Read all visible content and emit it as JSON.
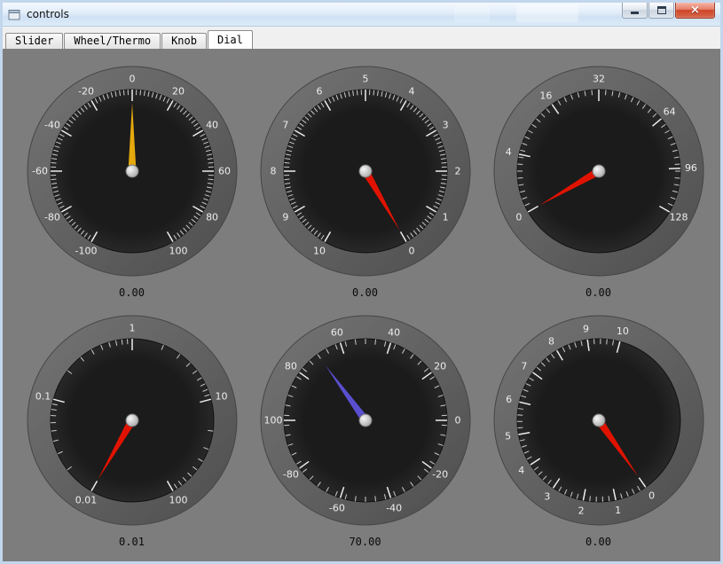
{
  "window": {
    "title": "controls"
  },
  "titlebar": {
    "close_glyph": "×"
  },
  "tabs": [
    {
      "label": "Slider",
      "selected": false
    },
    {
      "label": "Wheel/Thermo",
      "selected": false
    },
    {
      "label": "Knob",
      "selected": false
    },
    {
      "label": "Dial",
      "selected": true
    }
  ],
  "colors": {
    "panel_bg": "#7d7d7d",
    "bezel": "#5f5f5f",
    "dial_face": "#1e1e1e",
    "tick": "#dcdcdc",
    "scale_label": "#ededed",
    "needle_red": "#e11300",
    "needle_yellow": "#e5a90c",
    "needle_purple": "#5a4fcf",
    "hub": "#d9d9d9"
  },
  "dials": [
    {
      "caption": "0.00",
      "needle": {
        "angle": 0,
        "color": "#e5a90c"
      },
      "scale": {
        "start": -150,
        "end": 150,
        "minor_step": 3
      },
      "labels": [
        {
          "text": "-100",
          "angle": -150
        },
        {
          "text": "-80",
          "angle": -120
        },
        {
          "text": "-60",
          "angle": -90
        },
        {
          "text": "-40",
          "angle": -60
        },
        {
          "text": "-20",
          "angle": -30
        },
        {
          "text": "0",
          "angle": 0
        },
        {
          "text": "20",
          "angle": 30
        },
        {
          "text": "40",
          "angle": 60
        },
        {
          "text": "60",
          "angle": 90
        },
        {
          "text": "80",
          "angle": 120
        },
        {
          "text": "100",
          "angle": 150
        }
      ]
    },
    {
      "caption": "0.00",
      "needle": {
        "angle": 150,
        "color": "#e11300"
      },
      "scale": {
        "start": -150,
        "end": 150,
        "minor_step": 3
      },
      "labels": [
        {
          "text": "0",
          "angle": 150
        },
        {
          "text": "1",
          "angle": 120
        },
        {
          "text": "2",
          "angle": 90
        },
        {
          "text": "3",
          "angle": 60
        },
        {
          "text": "4",
          "angle": 30
        },
        {
          "text": "5",
          "angle": 0
        },
        {
          "text": "6",
          "angle": -30
        },
        {
          "text": "7",
          "angle": -60
        },
        {
          "text": "8",
          "angle": -90
        },
        {
          "text": "9",
          "angle": -120
        },
        {
          "text": "10",
          "angle": -150
        }
      ]
    },
    {
      "caption": "0.00",
      "needle": {
        "angle": -120,
        "color": "#e11300"
      },
      "scale": {
        "start": -120,
        "end": 120,
        "minor_step": 5
      },
      "labels": [
        {
          "text": "0",
          "angle": -120
        },
        {
          "text": "4",
          "angle": -78
        },
        {
          "text": "16",
          "angle": -35
        },
        {
          "text": "32",
          "angle": 0
        },
        {
          "text": "64",
          "angle": 50
        },
        {
          "text": "96",
          "angle": 88
        },
        {
          "text": "128",
          "angle": 120
        }
      ]
    },
    {
      "caption": "0.01",
      "needle": {
        "angle": -150,
        "color": "#e11300"
      },
      "scale": {
        "start": -150,
        "end": 150,
        "minor_angles": [
          -127.4,
          -114.2,
          -104.9,
          -97.6,
          -91.7,
          -86.6,
          -82.3,
          -78.4,
          -52.4,
          -39.2,
          -29.9,
          -22.6,
          -16.6,
          -11.6,
          -7.3,
          -3.4,
          22.6,
          35.8,
          45.2,
          52.4,
          58.4,
          63.4,
          67.7,
          71.6,
          97.6,
          110.8,
          120.2,
          127.4,
          133.4,
          138.4,
          142.7,
          146.6
        ]
      },
      "labels": [
        {
          "text": "0.01",
          "angle": -150
        },
        {
          "text": "0.1",
          "angle": -75
        },
        {
          "text": "1",
          "angle": 0
        },
        {
          "text": "10",
          "angle": 75
        },
        {
          "text": "100",
          "angle": 150
        }
      ]
    },
    {
      "caption": "70.00",
      "needle": {
        "angle": -36,
        "color": "#5a4fcf"
      },
      "scale": {
        "start": -180,
        "end": 172.8,
        "minor_step": 7.2
      },
      "labels": [
        {
          "text": "0",
          "angle": 90
        },
        {
          "text": "20",
          "angle": 54
        },
        {
          "text": "40",
          "angle": 18
        },
        {
          "text": "60",
          "angle": -18
        },
        {
          "text": "80",
          "angle": -54
        },
        {
          "text": "100",
          "angle": -90
        },
        {
          "text": "-20",
          "angle": 126
        },
        {
          "text": "-40",
          "angle": 162
        },
        {
          "text": "-60",
          "angle": -162
        },
        {
          "text": "-80",
          "angle": -126
        }
      ]
    },
    {
      "caption": "0.00",
      "needle": {
        "angle": 145,
        "color": "#e11300"
      },
      "scale": {
        "start": 145,
        "end": 375,
        "minor_step": 4.6
      },
      "labels": [
        {
          "text": "0",
          "angle": 145
        },
        {
          "text": "1",
          "angle": 168
        },
        {
          "text": "2",
          "angle": -169
        },
        {
          "text": "3",
          "angle": -146
        },
        {
          "text": "4",
          "angle": -123
        },
        {
          "text": "5",
          "angle": -100
        },
        {
          "text": "6",
          "angle": -77
        },
        {
          "text": "7",
          "angle": -54
        },
        {
          "text": "8",
          "angle": -31
        },
        {
          "text": "9",
          "angle": -8
        },
        {
          "text": "10",
          "angle": 15
        }
      ]
    }
  ]
}
